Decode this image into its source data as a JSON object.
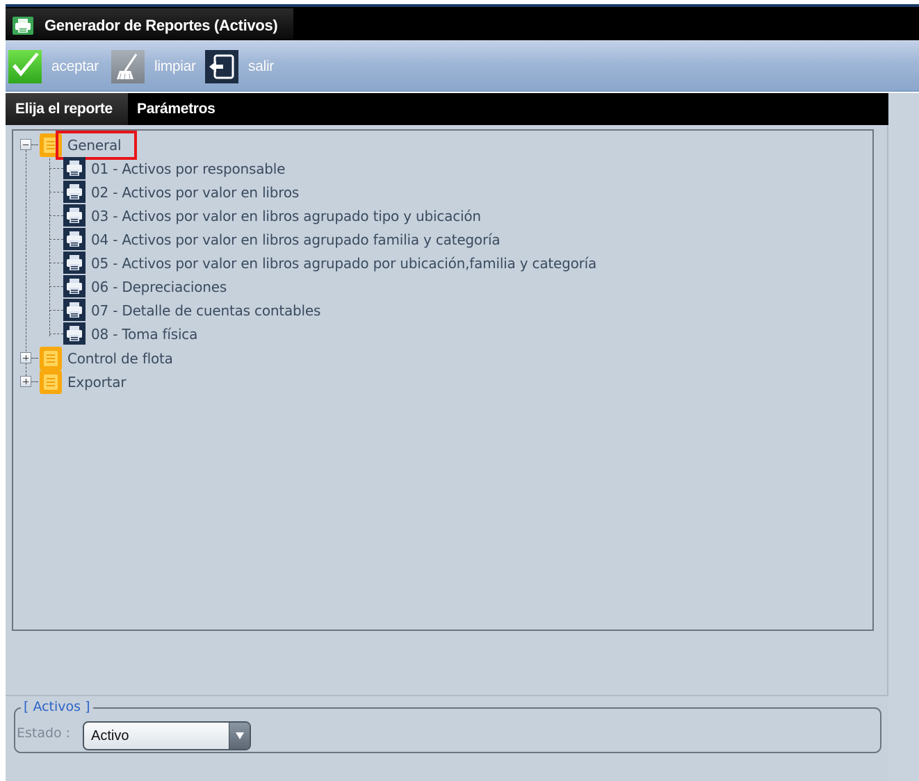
{
  "window": {
    "title": "Generador de Reportes (Activos)"
  },
  "toolbar": {
    "buttons": [
      {
        "label": "aceptar",
        "icon": "checkmark-icon"
      },
      {
        "label": "limpiar",
        "icon": "broom-icon"
      },
      {
        "label": "salir",
        "icon": "exit-icon"
      }
    ]
  },
  "tabs": [
    {
      "label": "Elija el reporte",
      "active": true
    },
    {
      "label": "Parámetros",
      "active": false
    }
  ],
  "tree": {
    "groups": [
      {
        "label": "General",
        "expanded": true,
        "selected": true,
        "items": [
          "01 - Activos por responsable",
          "02 - Activos por valor en libros",
          "03 - Activos por valor en libros agrupado tipo y ubicación",
          "04 - Activos por valor en libros agrupado familia y categoría",
          "05 - Activos por valor en libros agrupado por ubicación,familia y categoría",
          "06 - Depreciaciones",
          "07 - Detalle de cuentas contables",
          "08 - Toma física"
        ]
      },
      {
        "label": "Control de flota",
        "expanded": false
      },
      {
        "label": "Exportar",
        "expanded": false
      }
    ]
  },
  "filter": {
    "legend": "[ Activos ]",
    "estado_label": "Estado :",
    "estado_value": "Activo"
  },
  "colors": {
    "highlight": "#e8141b",
    "toolbar": "#9fb6d6",
    "panel": "#c7d1dc",
    "legend_text": "#2c63c8"
  }
}
